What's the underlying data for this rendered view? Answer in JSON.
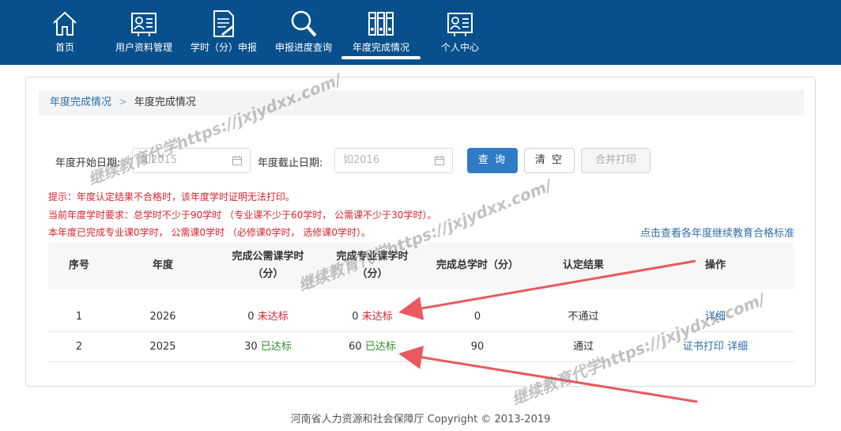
{
  "nav": {
    "items": [
      {
        "label": "首页",
        "icon": "home-icon"
      },
      {
        "label": "用户资料管理",
        "icon": "user-card-icon"
      },
      {
        "label": "学时（分）申报",
        "icon": "document-pen-icon"
      },
      {
        "label": "申报进度查询",
        "icon": "magnifier-icon"
      },
      {
        "label": "年度完成情况",
        "icon": "binders-icon",
        "active": true
      },
      {
        "label": "个人中心",
        "icon": "user-card-icon"
      }
    ],
    "bg_color": "#08508c"
  },
  "breadcrumb": {
    "link": "年度完成情况",
    "separator": ">",
    "current": "年度完成情况"
  },
  "filters": {
    "start_label": "年度开始日期:",
    "start_placeholder": "如2015",
    "end_label": "年度截止日期:",
    "end_placeholder": "如2016",
    "query_button": "查 询",
    "clear_button": "清 空",
    "print_button": "合并打印"
  },
  "notices": [
    "提示：年度认定结果不合格时，该年度学时证明无法打印。",
    "当前年度学时要求：总学时不少于90学时 （专业课不少于60学时， 公需课不少于30学时）。",
    "本年度已完成专业课0学时， 公需课0学时 （必修课0学时， 选修课0学时）。"
  ],
  "standard_link": "点击查看各年度继续教育合格标准",
  "table": {
    "headers": [
      "序号",
      "年度",
      "完成公需课学时\n（分）",
      "完成专业课学时\n（分）",
      "完成总学时（分）",
      "认定结果",
      "操作"
    ],
    "rows": [
      {
        "index": "1",
        "year": "2026",
        "public_value": "0",
        "public_status": "未达标",
        "public_ok": false,
        "pro_value": "0",
        "pro_status": "未达标",
        "pro_ok": false,
        "total": "0",
        "result": "不通过",
        "actions": [
          "详细"
        ]
      },
      {
        "index": "2",
        "year": "2025",
        "public_value": "30",
        "public_status": "已达标",
        "public_ok": true,
        "pro_value": "60",
        "pro_status": "已达标",
        "pro_ok": true,
        "total": "90",
        "result": "通过",
        "actions": [
          "证书打印",
          "详细"
        ]
      }
    ]
  },
  "footer": "河南省人力资源和社会保障厅 Copyright © 2013-2019",
  "watermark_text": "继续教育代学https://jxjydxx.com/",
  "colors": {
    "accent": "#2f7bc6",
    "fail": "#d9232b",
    "pass": "#2e8b2e",
    "link": "#2f6fa7",
    "arrow": "#e85a5f"
  }
}
